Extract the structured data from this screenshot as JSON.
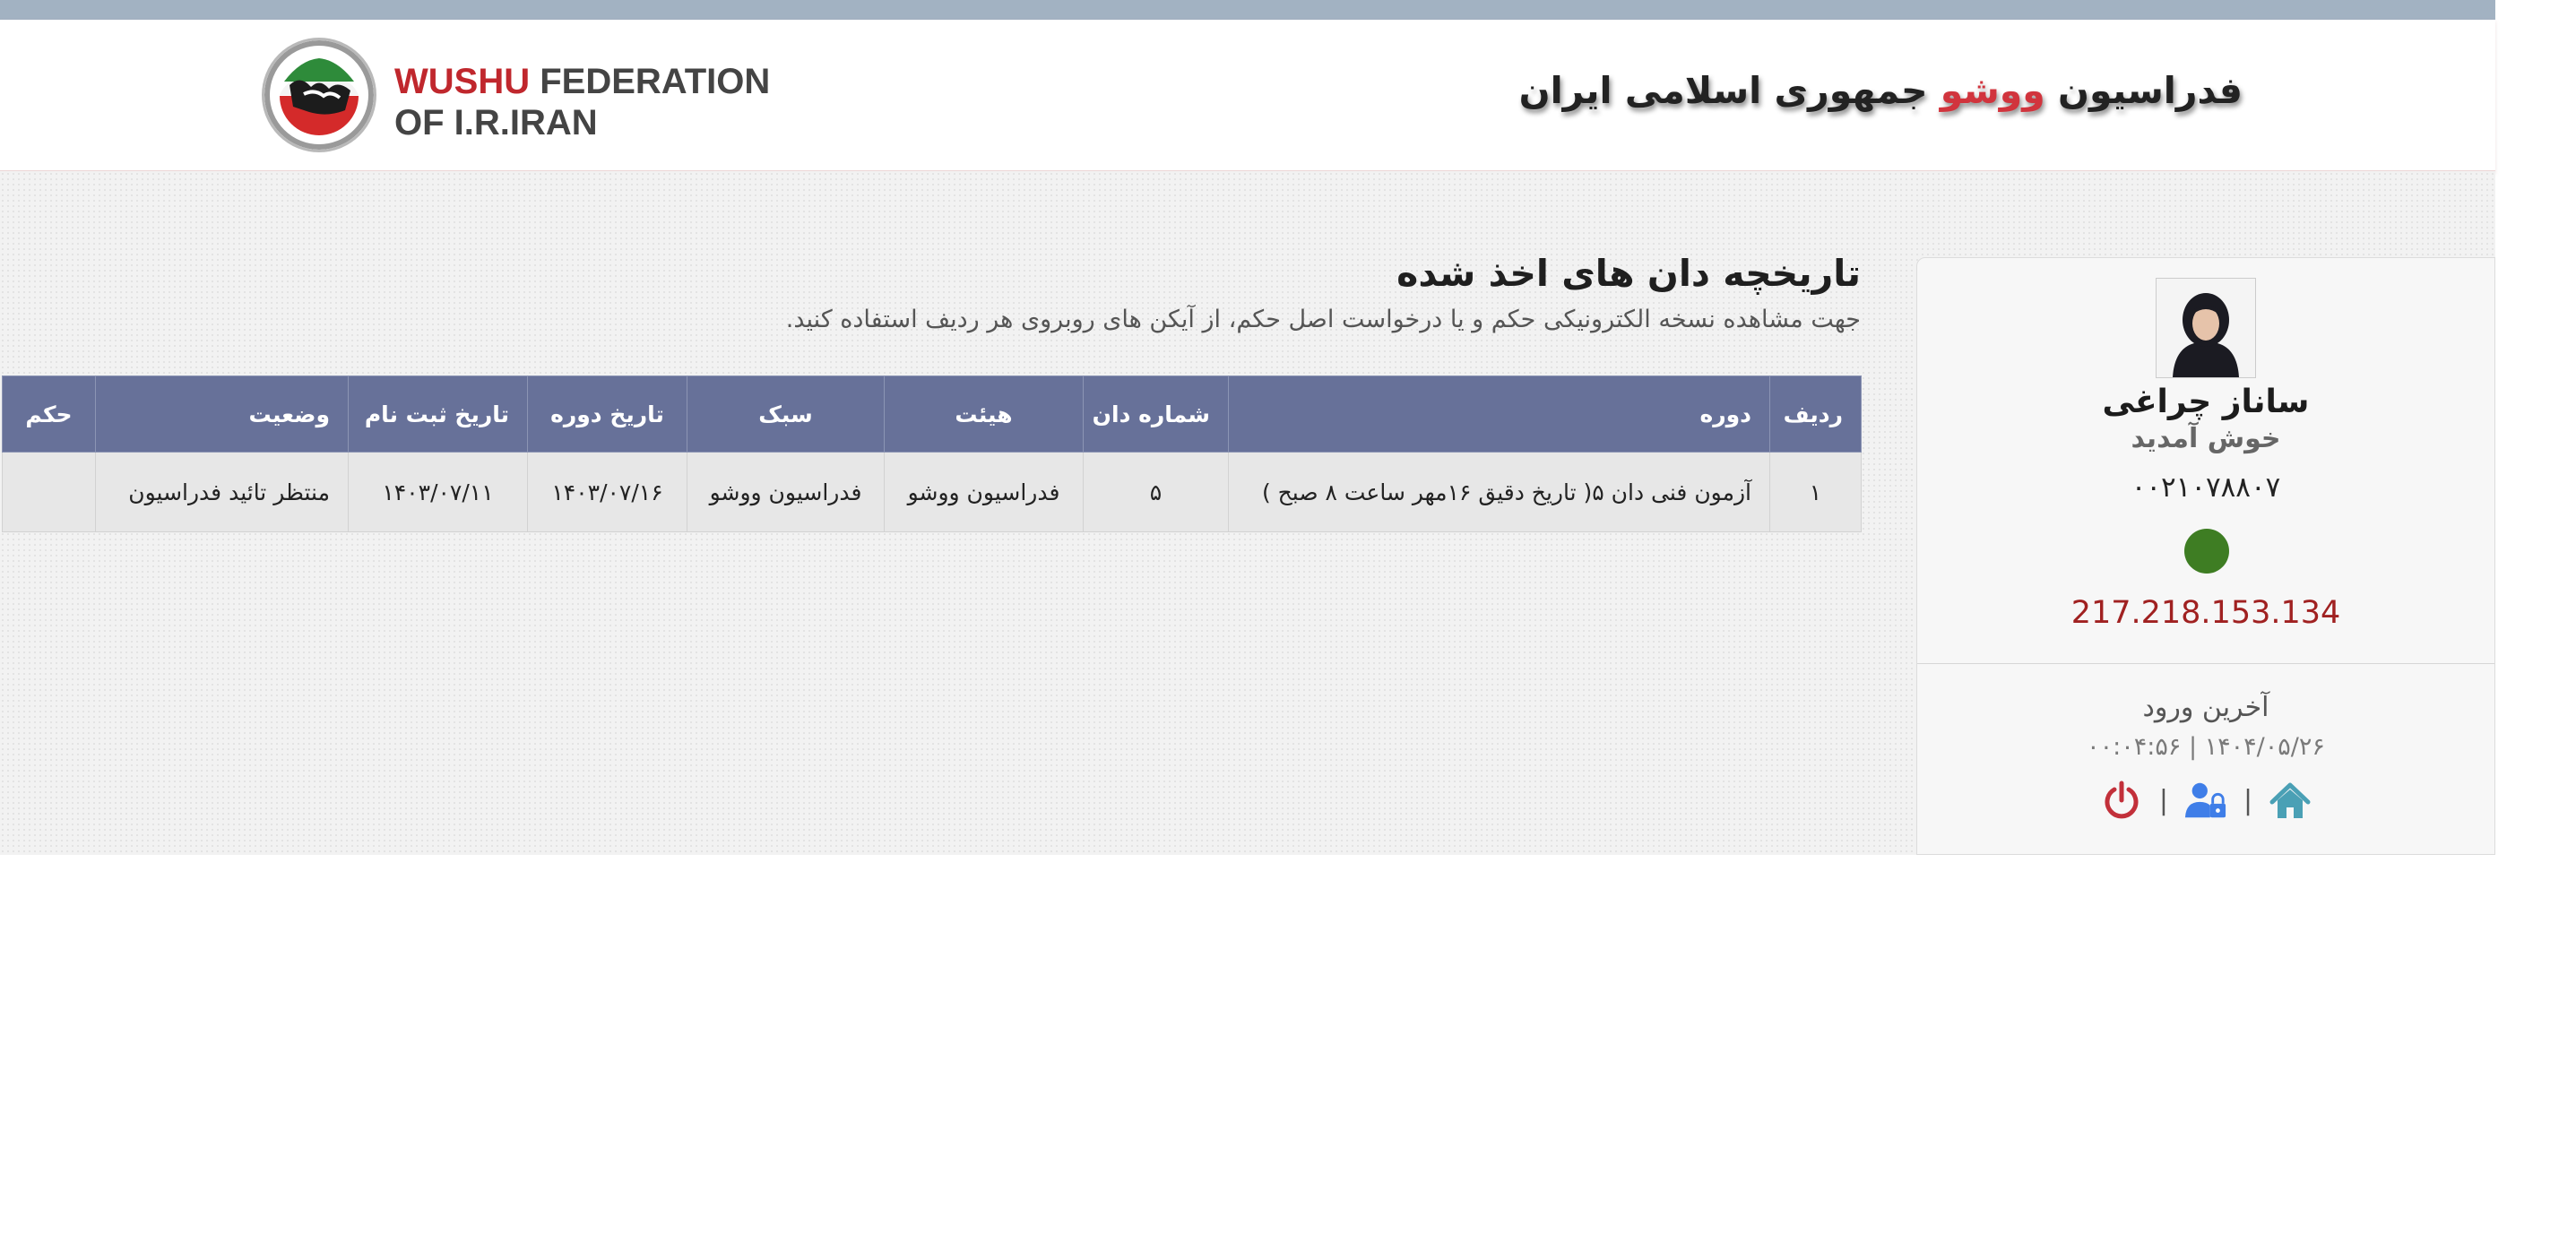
{
  "header": {
    "logo_line1_red": "WUSHU",
    "logo_line1_rest": " FEDERATION",
    "logo_line2": "OF I.R.IRAN",
    "title_part1": "فدراسیون ",
    "title_red": "ووشو",
    "title_part2": " جمهوری اسلامی ایران"
  },
  "profile": {
    "name": "ساناز چراغی",
    "welcome": "خوش آمدید",
    "code": "۰۰۲۱۰۷۸۸۰۷",
    "status_color": "#3e7d23",
    "ip": "217.218.153.134",
    "last_login_label": "آخرین ورود",
    "last_login_time": "۰۰:۰۴:۵۶ | ۱۴۰۴/۰۵/۲۶",
    "actions": [
      {
        "icon": "home-icon",
        "color": "#4aa0b5"
      },
      {
        "icon": "user-lock-icon",
        "color": "#3f7ee8"
      },
      {
        "icon": "power-icon",
        "color": "#c2303a"
      }
    ],
    "separator": "|"
  },
  "content": {
    "title": "تاریخچه دان های اخذ شده",
    "subtitle": "جهت مشاهده نسخه الکترونیکی حکم و یا درخواست اصل حکم، از آیکن های روبروی هر ردیف استفاده کنید."
  },
  "table": {
    "headers": {
      "row": "ردیف",
      "course": "دوره",
      "dan": "شماره دان",
      "board": "هیئت",
      "style": "سبک",
      "course_date": "تاریخ دوره",
      "reg_date": "تاریخ ثبت نام",
      "status": "وضعیت",
      "verdict": "حکم"
    },
    "rows": [
      {
        "row": "۱",
        "course": "آزمون فنی دان ۵( تاریخ دقیق ۱۶مهر ساعت ۸ صبح )",
        "dan": "۵",
        "board": "فدراسیون ووشو",
        "style": "فدراسیون ووشو",
        "course_date": "۱۴۰۳/۰۷/۱۶",
        "reg_date": "۱۴۰۳/۰۷/۱۱",
        "status": "منتظر تائید فدراسیون",
        "verdict": ""
      }
    ]
  }
}
